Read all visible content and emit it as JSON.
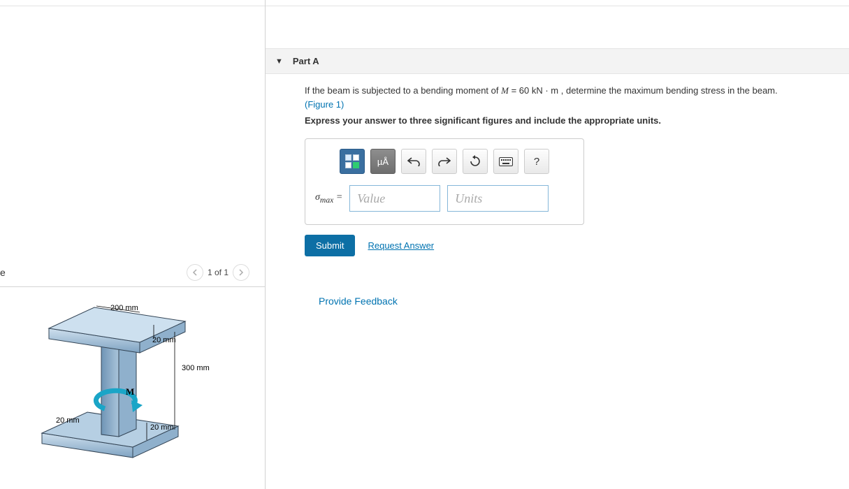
{
  "leftPanel": {
    "figureLabel": "e",
    "pager": {
      "text": "1 of 1"
    },
    "diagram": {
      "dim_top": "200 mm",
      "dim_flange": "20 mm",
      "dim_height": "300 mm",
      "dim_web": "20 mm",
      "dim_left": "20 mm",
      "moment_label": "M"
    }
  },
  "part": {
    "title": "Part A",
    "question_prefix": "If the beam is subjected to a bending moment of ",
    "question_M": "M",
    "question_eq": " = 60  kN · m",
    "question_suffix": " , determine the maximum bending stress in the beam.",
    "figure_link": "(Figure 1)",
    "instruction": "Express your answer to three significant figures and include the appropriate units.",
    "toolbar": {
      "templates_title": "templates",
      "special_label": "µÅ",
      "undo_title": "undo",
      "redo_title": "redo",
      "reset_title": "reset",
      "keyboard_title": "keyboard",
      "help_label": "?"
    },
    "sigma_html": "σ",
    "sigma_sub": "max",
    "equals": " =",
    "value_placeholder": "Value",
    "units_placeholder": "Units",
    "submit_label": "Submit",
    "request_label": "Request Answer"
  },
  "feedback": {
    "label": "Provide Feedback"
  }
}
